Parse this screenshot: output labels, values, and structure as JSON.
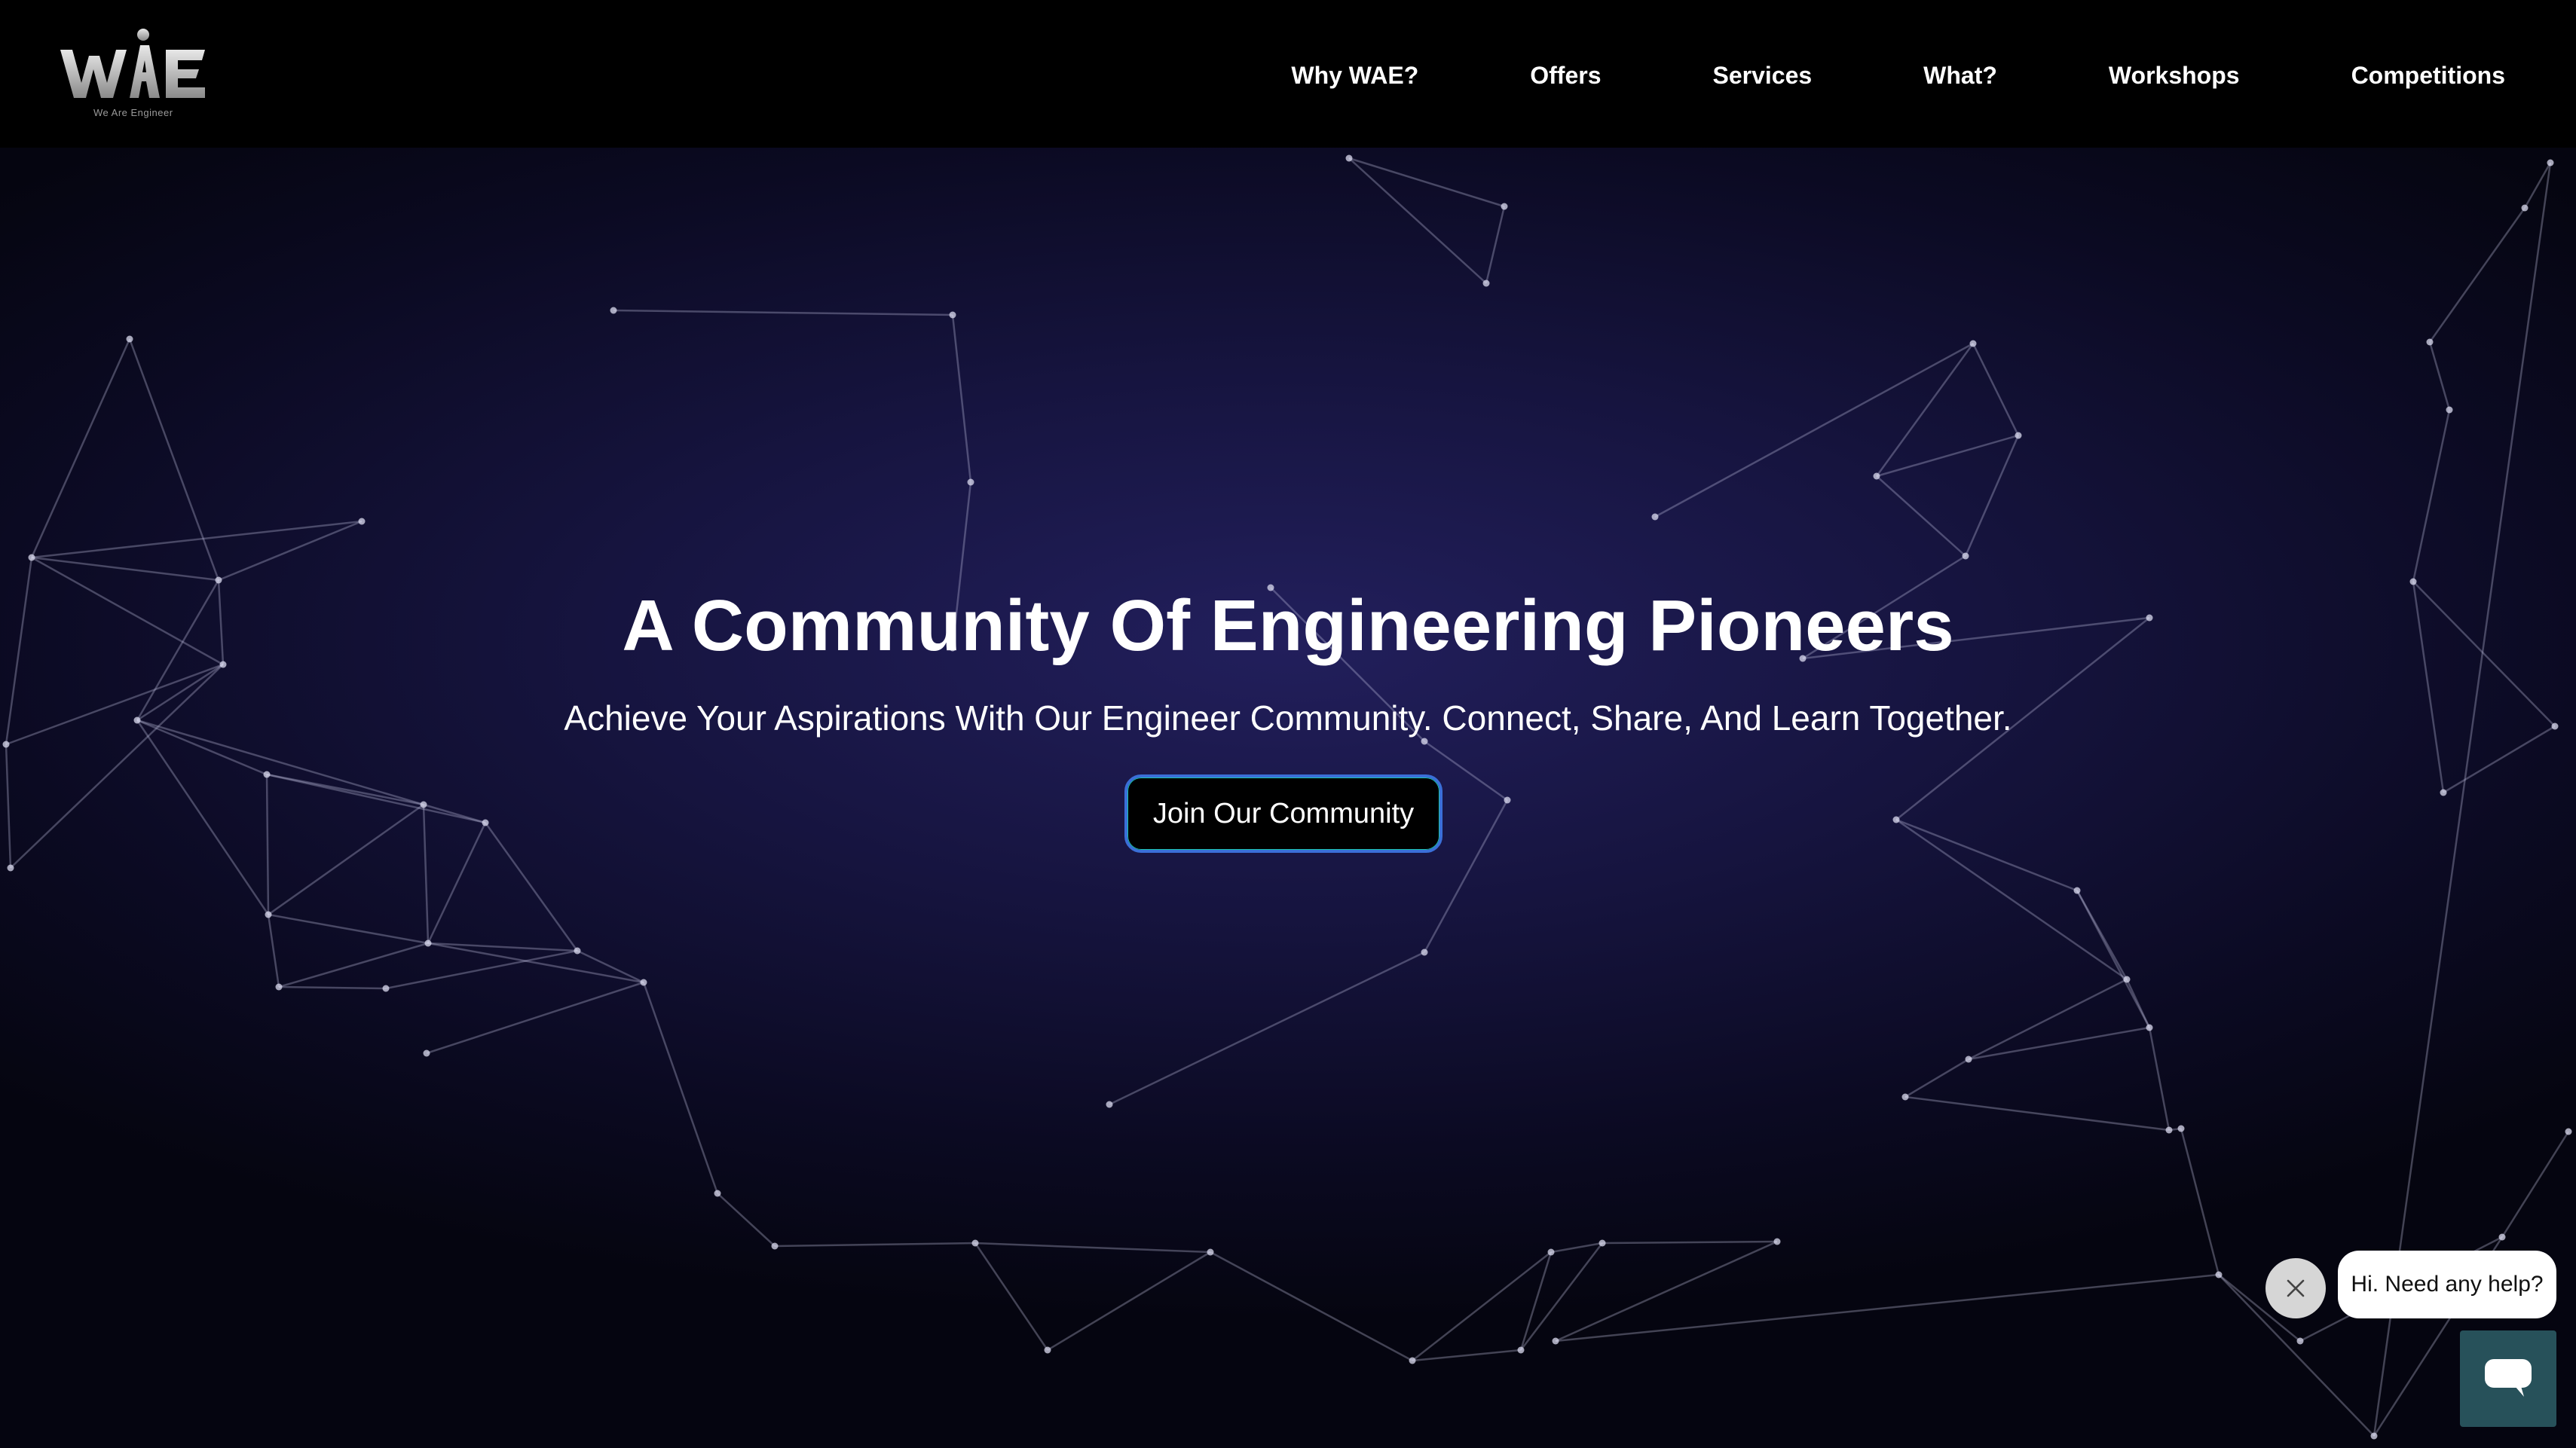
{
  "header": {
    "logo": {
      "text": "WAE",
      "tagline": "We Are Engineer"
    },
    "nav": [
      {
        "label": "Why WAE?"
      },
      {
        "label": "Offers"
      },
      {
        "label": "Services"
      },
      {
        "label": "What?"
      },
      {
        "label": "Workshops"
      },
      {
        "label": "Competitions"
      }
    ]
  },
  "hero": {
    "title": "A Community Of Engineering Pioneers",
    "subtitle": "Achieve Your Aspirations With Our Engineer Community. Connect, Share, And Learn Together.",
    "cta_label": "Join Our Community"
  },
  "chat": {
    "greeting": "Hi. Need any help?",
    "close_icon": "close-icon",
    "launcher_icon": "chat-icon"
  },
  "colors": {
    "header_bg": "#000000",
    "hero_glow": "#221f5c",
    "hero_dark": "#050510",
    "cta_border": "#3a6fd8",
    "chat_launcher": "#27515a"
  }
}
